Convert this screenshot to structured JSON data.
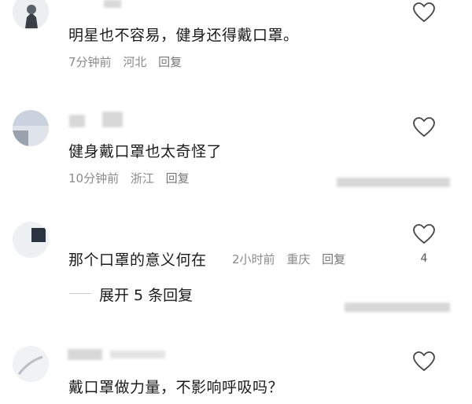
{
  "comments": [
    {
      "text": "明星也不容易，健身还得戴口罩。",
      "time": "7分钟前",
      "location": "河北",
      "reply_label": "回复"
    },
    {
      "text": "健身戴口罩也太奇怪了",
      "time": "10分钟前",
      "location": "浙江",
      "reply_label": "回复"
    },
    {
      "text": "那个口罩的意义何在",
      "time": "2小时前",
      "location": "重庆",
      "reply_label": "回复",
      "like_count": "4",
      "expand_label": "展开 5 条回复"
    },
    {
      "text": "戴口罩做力量，不影响呼吸吗？"
    }
  ],
  "icons": {
    "like": "heart-outline-icon"
  },
  "colors": {
    "meta": "#8a8a8a",
    "text": "#1b1b1b",
    "background": "#ffffff"
  }
}
